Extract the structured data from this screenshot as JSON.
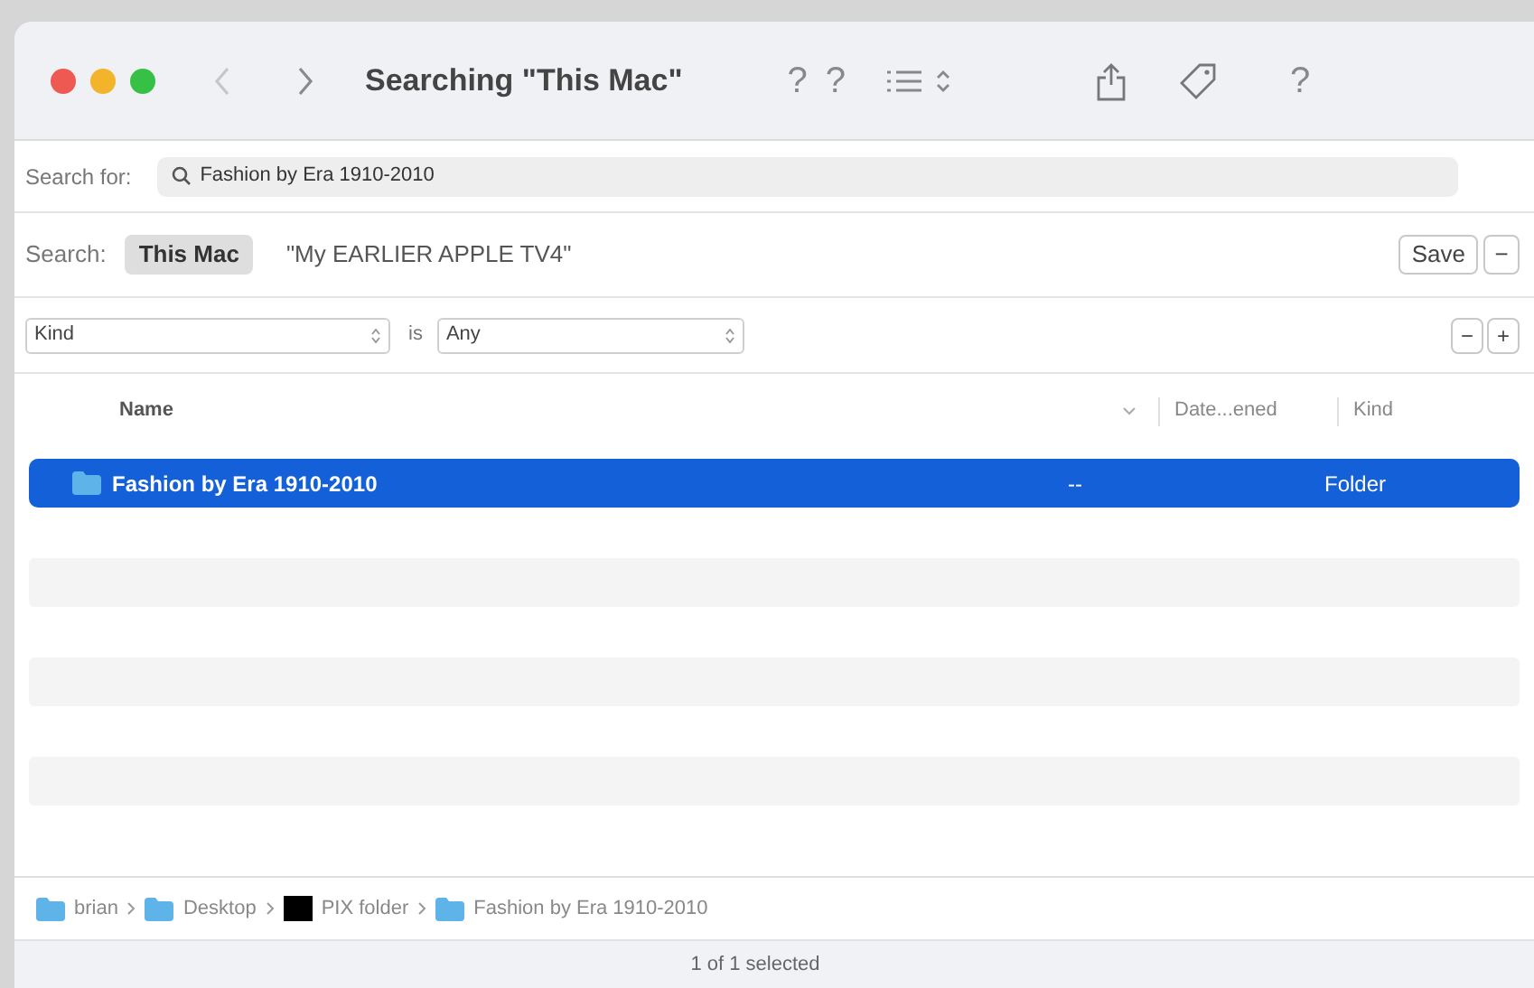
{
  "window": {
    "title": "Searching \"This Mac\""
  },
  "toolbar": {
    "items": [
      "?",
      "?",
      "?"
    ]
  },
  "search_for": {
    "label": "Search for:",
    "value": "Fashion by Era 1910-2010"
  },
  "scope": {
    "label": "Search:",
    "options": [
      {
        "label": "This Mac",
        "selected": true
      },
      {
        "label": "\"My EARLIER APPLE TV4\"",
        "selected": false
      }
    ],
    "save": "Save",
    "remove": "−"
  },
  "criteria": {
    "attribute": "Kind",
    "operator": "is",
    "value": "Any",
    "remove": "−",
    "add": "+"
  },
  "table": {
    "columns": [
      "Name",
      "Date...ened",
      "Kind"
    ],
    "rows": [
      {
        "name": "Fashion by Era 1910-2010",
        "date": "--",
        "kind": "Folder",
        "selected": true
      }
    ]
  },
  "path_bar": [
    {
      "label": "brian",
      "kind": "folder"
    },
    {
      "label": "Desktop",
      "kind": "folder"
    },
    {
      "label": "PIX folder",
      "kind": "image"
    },
    {
      "label": "Fashion by Era 1910-2010",
      "kind": "folder"
    }
  ],
  "status_bar": "1 of 1 selected"
}
